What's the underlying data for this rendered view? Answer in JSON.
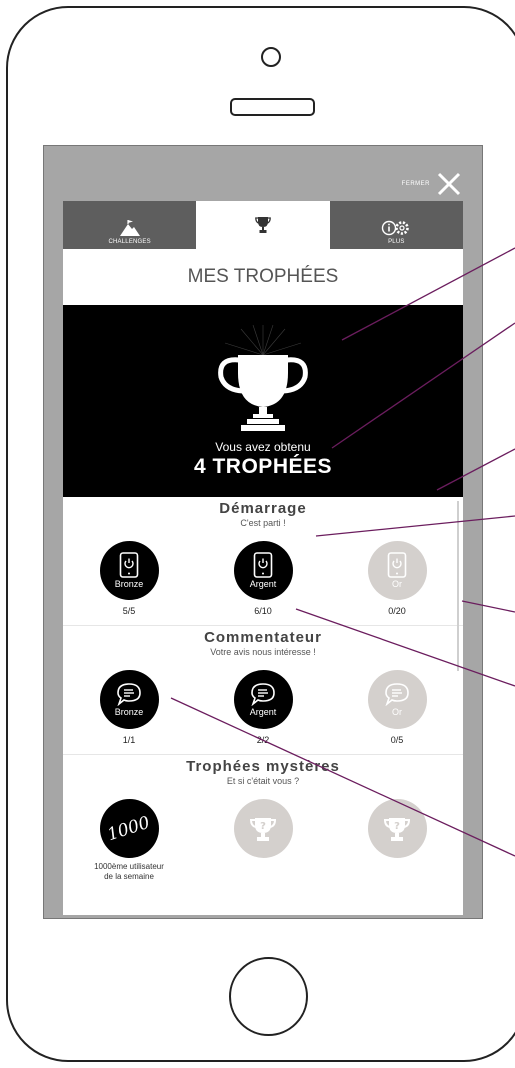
{
  "close": {
    "label": "FERMER"
  },
  "tabs": [
    {
      "label": "CHALLENGES",
      "icon": "mountain-flag-icon"
    },
    {
      "label": "",
      "icon": "trophy-icon"
    },
    {
      "label": "PLUS",
      "icon": "info-gear-icon"
    }
  ],
  "page_title": "MES TROPHÉES",
  "hero": {
    "subtitle": "Vous avez obtenu",
    "count_text": "4 TROPHÉES"
  },
  "sections": [
    {
      "title": "Démarrage",
      "subtitle": "C'est parti !",
      "badges": [
        {
          "level": "Bronze",
          "progress": "5/5",
          "earned": true
        },
        {
          "level": "Argent",
          "progress": "6/10",
          "earned": true
        },
        {
          "level": "Or",
          "progress": "0/20",
          "earned": false
        }
      ]
    },
    {
      "title": "Commentateur",
      "subtitle": "Votre avis nous intéresse !",
      "badges": [
        {
          "level": "Bronze",
          "progress": "1/1",
          "earned": true
        },
        {
          "level": "Argent",
          "progress": "2/2",
          "earned": true
        },
        {
          "level": "Or",
          "progress": "0/5",
          "earned": false
        }
      ]
    },
    {
      "title": "Trophées mystères",
      "subtitle": "Et si c'était vous ?",
      "badges": [
        {
          "badge_text": "1000",
          "label_line1": "1000ème utilisateur",
          "label_line2": "de la semaine",
          "earned": true
        },
        {
          "badge_text": "?",
          "earned": false
        },
        {
          "badge_text": "?",
          "earned": false
        }
      ]
    }
  ],
  "colors": {
    "tab_bg": "#5e5e5e",
    "overlay": "#a6a6a6",
    "earned": "#000000",
    "locked": "#d4d0cd",
    "annotation": "#6b1d5e"
  }
}
